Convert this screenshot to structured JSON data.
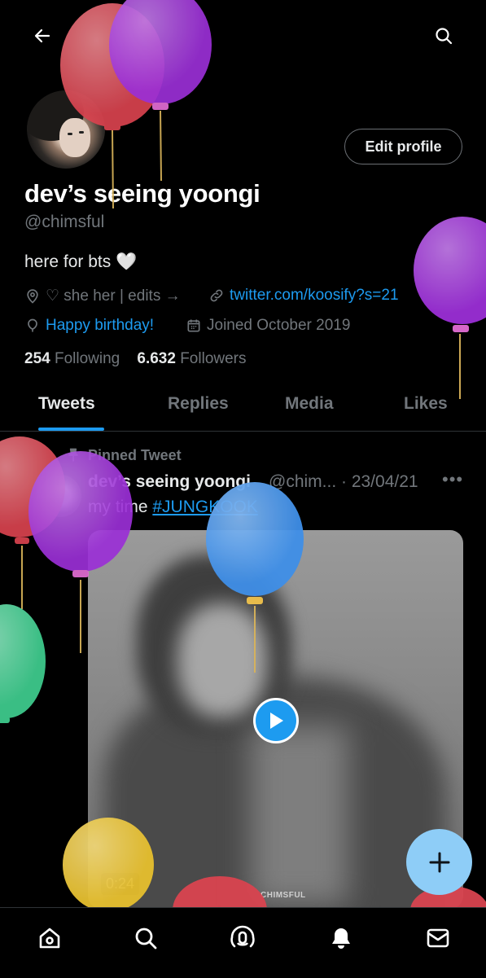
{
  "colors": {
    "background": "#000000",
    "accent": "#1d9bf0",
    "text_primary": "#e7e9ea",
    "text_secondary": "#71767b",
    "fab": "#8ecdf7",
    "balloon_red": "#d9434f",
    "balloon_purple": "#9b2fd6",
    "balloon_blue": "#3f8fe8",
    "balloon_green": "#3ec98c",
    "balloon_yellow": "#e6bf2e"
  },
  "header": {
    "back_icon": "arrow-left-icon",
    "search_icon": "search-icon"
  },
  "profile": {
    "edit_profile_label": "Edit profile",
    "display_name": "dev’s seeing yoongi",
    "handle": "@chimsful",
    "bio": "here for bts 🤍",
    "location": "♡ she her | edits →",
    "website": "twitter.com/koosify?s=21",
    "birthday": "Happy birthday!",
    "joined": "Joined October 2019",
    "following_count": "254",
    "following_label": "Following",
    "followers_count": "6.632",
    "followers_label": "Followers"
  },
  "tabs": [
    {
      "label": "Tweets",
      "active": true
    },
    {
      "label": "Replies",
      "active": false
    },
    {
      "label": "Media",
      "active": false
    },
    {
      "label": "Likes",
      "active": false
    }
  ],
  "pinned_tweet": {
    "pinned_label": "Pinned Tweet",
    "author_name": "dev’s seeing yoongi",
    "author_handle_date": "@chim... · 23/04/21",
    "more_label": "•••",
    "text_prefix": "my time ",
    "hashtag": "#JUNGKOOK",
    "video_duration": "0:24",
    "watermark": "CHIMSFUL"
  },
  "bottom_nav": [
    "home-icon",
    "search-icon",
    "spaces-icon",
    "notifications-icon",
    "messages-icon"
  ]
}
